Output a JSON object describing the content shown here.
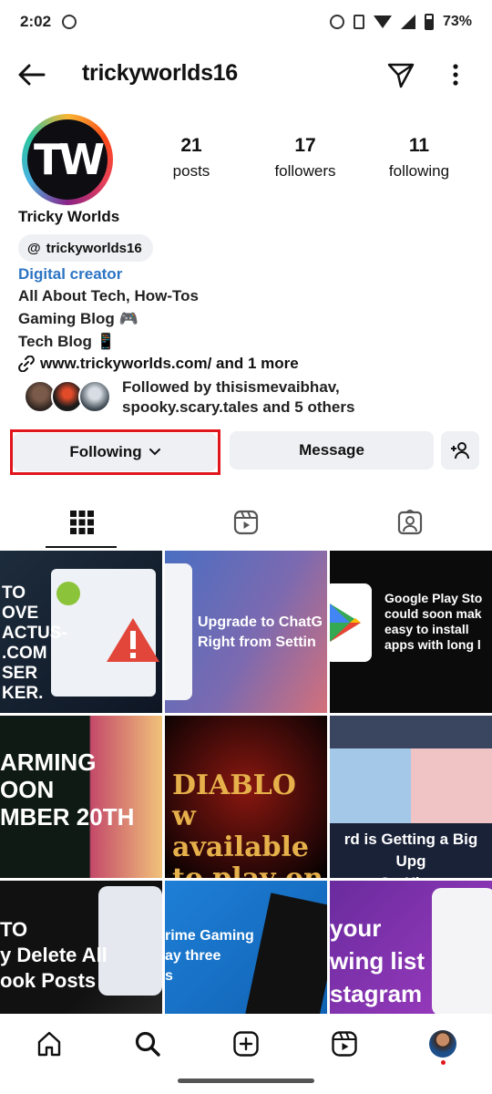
{
  "status_bar": {
    "time": "2:02",
    "battery": "73%"
  },
  "header": {
    "username": "trickyworlds16"
  },
  "profile": {
    "avatar_text": "TW",
    "stats": [
      {
        "value": "21",
        "label": "posts"
      },
      {
        "value": "17",
        "label": "followers"
      },
      {
        "value": "11",
        "label": "following"
      }
    ],
    "display_name": "Tricky Worlds",
    "threads_handle": "trickyworlds16",
    "category": "Digital creator",
    "bio": [
      "All About Tech, How-Tos",
      "Gaming Blog 🎮",
      "Tech Blog 📱"
    ],
    "link": "www.trickyworlds.com/ and 1 more",
    "followed_by": {
      "line1": "Followed by thisismevaibhav,",
      "line2": "spooky.scary.tales and 5 others"
    }
  },
  "actions": {
    "following_label": "Following",
    "message_label": "Message"
  },
  "grid": {
    "posts": [
      {
        "text": "TO\nOVE\nACTUS-\n.COM\nSER\nKER."
      },
      {
        "text": "Upgrade to ChatG\nRight from Settin"
      },
      {
        "text": "Google Play Sto\ncould soon mak\neasy to install\napps with long l"
      },
      {
        "text": "ARMING\nOON\nMBER 20TH"
      },
      {
        "text": "DIABLO\nw available to play on web brow"
      },
      {
        "text": "rd is Getting a Big Upg\nOn Xbox"
      },
      {
        "text": "TO\ny Delete All\nook Posts"
      },
      {
        "text": "rime Gaming\nay three\ns"
      },
      {
        "text": "your\nwing list\nstagram"
      }
    ]
  },
  "colors": {
    "accent_link": "#2d74c4",
    "highlight": "#e0161c",
    "button_bg": "#eef0f3"
  }
}
